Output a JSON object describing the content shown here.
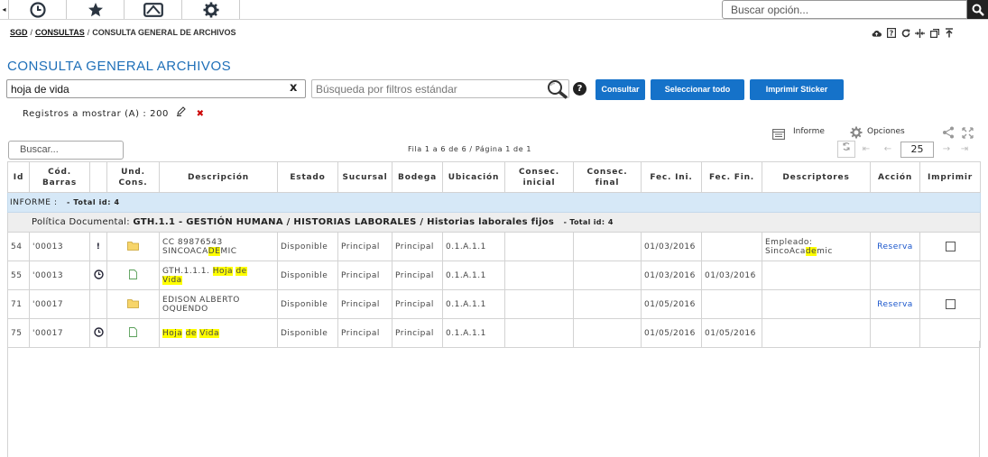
{
  "topbar": {
    "arrow": "◂",
    "tabs": [
      {
        "icon": "clock-icon"
      },
      {
        "icon": "star-icon"
      },
      {
        "icon": "folder-icon"
      },
      {
        "icon": "gear-icon"
      }
    ],
    "search_placeholder": "Buscar opción..."
  },
  "breadcrumb": {
    "root": "SGD",
    "section": "CONSULTAS",
    "current": "CONSULTA GENERAL DE ARCHIVOS"
  },
  "title": "CONSULTA GENERAL ARCHIVOS",
  "search": {
    "query": "hoja de vida",
    "clear": "x",
    "filter_placeholder": "Búsqueda por filtros estándar",
    "help": "?"
  },
  "buttons": {
    "consultar": "Consultar",
    "seleccionar": "Seleccionar todo",
    "imprimir": "Imprimir Sticker"
  },
  "registros": {
    "label": "Registros a mostrar (A) :",
    "value": "200"
  },
  "toolbar": {
    "informe": "Informe",
    "opciones": "Opciones"
  },
  "buscar_placeholder": "Buscar...",
  "pageinfo": "Fila 1 a 6 de 6 / Página 1 de 1",
  "pager": {
    "rows_per_page": "25"
  },
  "table": {
    "headers": {
      "id": "Id",
      "cod": "Cód. Barras",
      "und": "Und. Cons.",
      "desc": "Descripción",
      "estado": "Estado",
      "sucursal": "Sucursal",
      "bodega": "Bodega",
      "ubicacion": "Ubicación",
      "cinicial": "Consec. inicial",
      "cfinal": "Consec. final",
      "fini": "Fec. Ini.",
      "ffin": "Fec. Fin.",
      "descriptores": "Descriptores",
      "accion": "Acción",
      "imprimir": "Imprimir"
    },
    "band": {
      "label": "INFORME :",
      "total": "- Total id:",
      "count": "4"
    },
    "group": {
      "prefix": "Política Documental:",
      "name": "GTH.1.1 - GESTIÓN HUMANA / HISTORIAS LABORALES / Historias laborales fijos",
      "total": "- Total id:",
      "count": "4"
    },
    "rows": [
      {
        "id": "54",
        "cod": "'00013",
        "flag": "!",
        "type": "folder",
        "desc_line1": "CC 89876543",
        "desc_pre": "SINCOACA",
        "desc_hl": "DE",
        "desc_post": "MIC",
        "estado": "Disponible",
        "sucursal": "Principal",
        "bodega": "Principal",
        "ubicacion": "0.1.A.1.1",
        "fini": "01/03/2016",
        "ffin": "",
        "descr_line1": "Empleado:",
        "descr_pre": "SincoAca",
        "descr_hl": "de",
        "descr_post": "mic",
        "accion": "Reserva"
      },
      {
        "id": "55",
        "cod": "'00013",
        "flag": "clock",
        "type": "file",
        "desc_pre": "GTH.1.1.1.",
        "desc_hl1": "Hoja",
        "desc_hl2": "de",
        "desc_hl3": "Vida",
        "estado": "Disponible",
        "sucursal": "Principal",
        "bodega": "Principal",
        "ubicacion": "0.1.A.1.1",
        "fini": "01/03/2016",
        "ffin": "01/03/2016"
      },
      {
        "id": "71",
        "cod": "'00017",
        "flag": "",
        "type": "folder",
        "desc_line1": "EDISON ALBERTO",
        "desc_line2": "OQUENDO",
        "estado": "Disponible",
        "sucursal": "Principal",
        "bodega": "Principal",
        "ubicacion": "0.1.A.1.1",
        "fini": "01/05/2016",
        "ffin": "",
        "accion": "Reserva"
      },
      {
        "id": "75",
        "cod": "'00017",
        "flag": "clock",
        "type": "file",
        "desc_hl1": "Hoja",
        "desc_hl2": "de",
        "desc_hl3": "Vida",
        "estado": "Disponible",
        "sucursal": "Principal",
        "bodega": "Principal",
        "ubicacion": "0.1.A.1.1",
        "fini": "01/05/2016",
        "ffin": "01/05/2016"
      }
    ]
  },
  "colors": {
    "accent": "#1572c9",
    "title": "#1e6fb8",
    "band": "#d6e8f7",
    "highlight": "#ffff00"
  }
}
